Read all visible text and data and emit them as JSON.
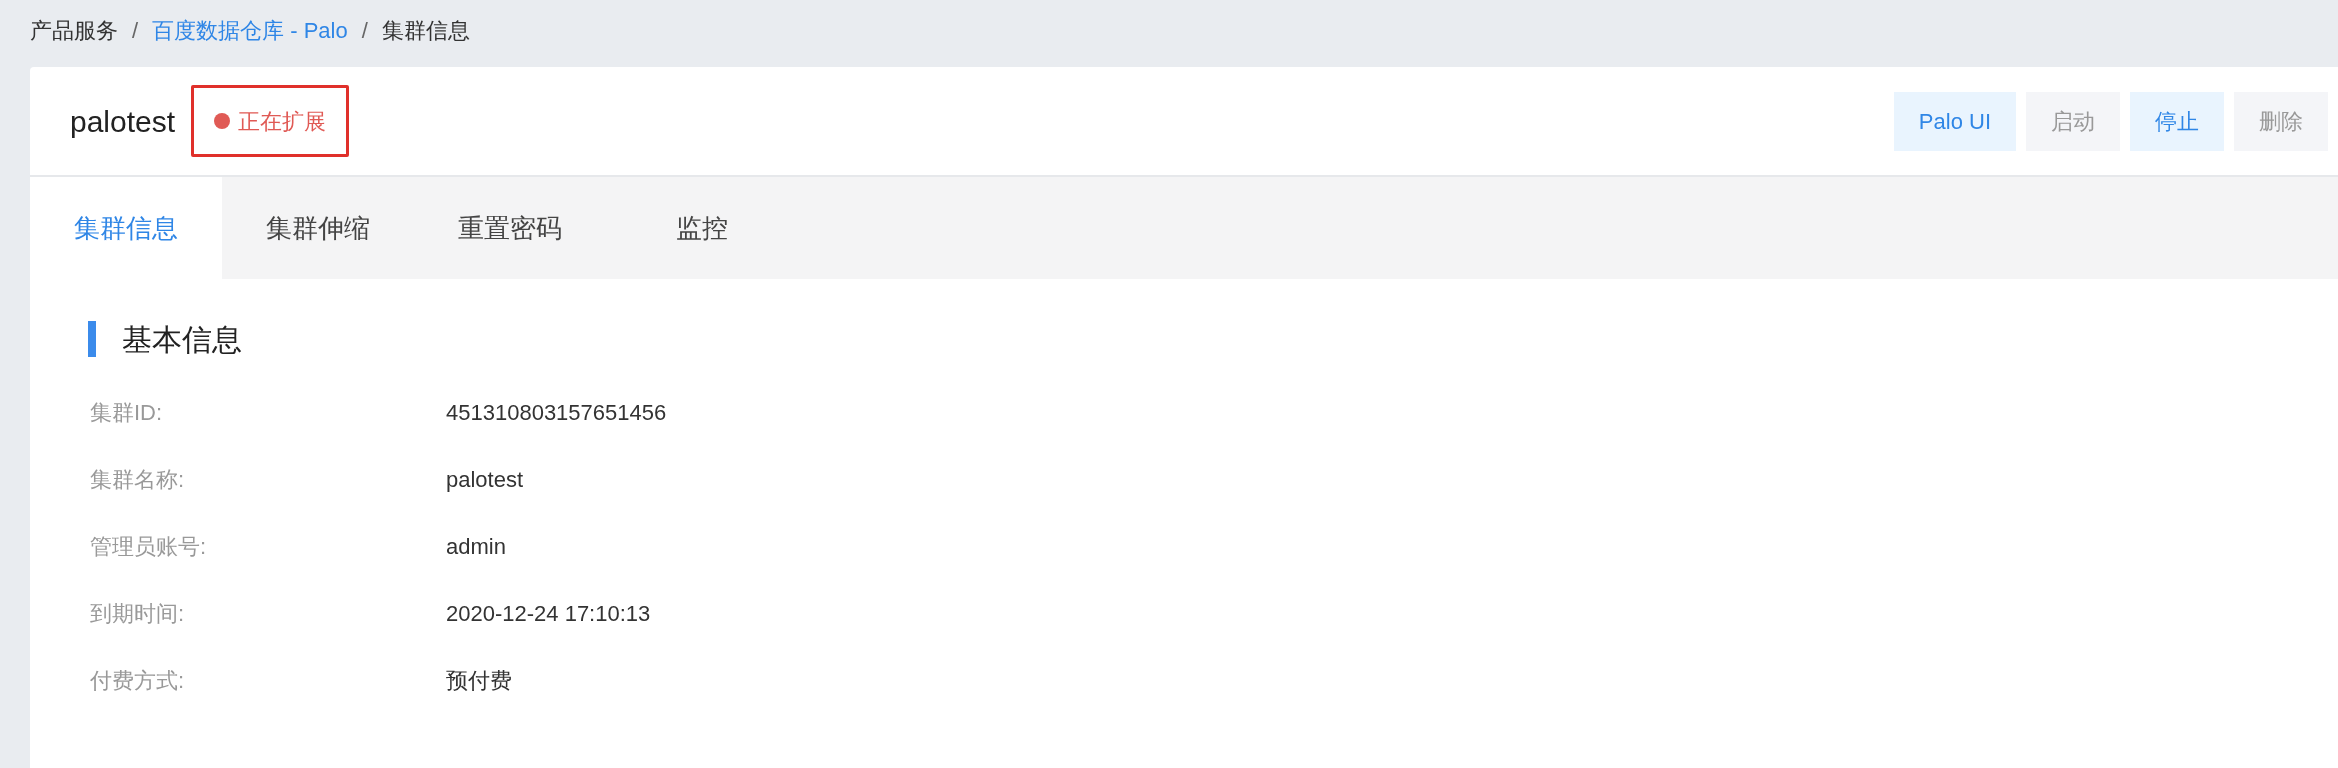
{
  "breadcrumb": [
    {
      "label": "产品服务",
      "link": false
    },
    {
      "label": "百度数据仓库 - Palo",
      "link": true
    },
    {
      "label": "集群信息",
      "link": false
    }
  ],
  "breadcrumb_separator": "/",
  "cluster": {
    "name": "palotest",
    "status": {
      "label": "正在扩展",
      "color": "#e05a55",
      "highlighted": true
    }
  },
  "actions": [
    {
      "label": "Palo UI",
      "disabled": false
    },
    {
      "label": "启动",
      "disabled": true
    },
    {
      "label": "停止",
      "disabled": false
    },
    {
      "label": "删除",
      "disabled": true
    }
  ],
  "tabs": [
    {
      "label": "集群信息",
      "selected": true
    },
    {
      "label": "集群伸缩",
      "selected": false
    },
    {
      "label": "重置密码",
      "selected": false
    },
    {
      "label": "监控",
      "selected": false
    }
  ],
  "section": {
    "title": "基本信息",
    "fields": [
      {
        "label": "集群ID:",
        "value": "451310803157651456"
      },
      {
        "label": "集群名称:",
        "value": "palotest"
      },
      {
        "label": "管理员账号:",
        "value": "admin"
      },
      {
        "label": "到期时间:",
        "value": "2020-12-24 17:10:13"
      },
      {
        "label": "付费方式:",
        "value": "预付费"
      }
    ]
  }
}
